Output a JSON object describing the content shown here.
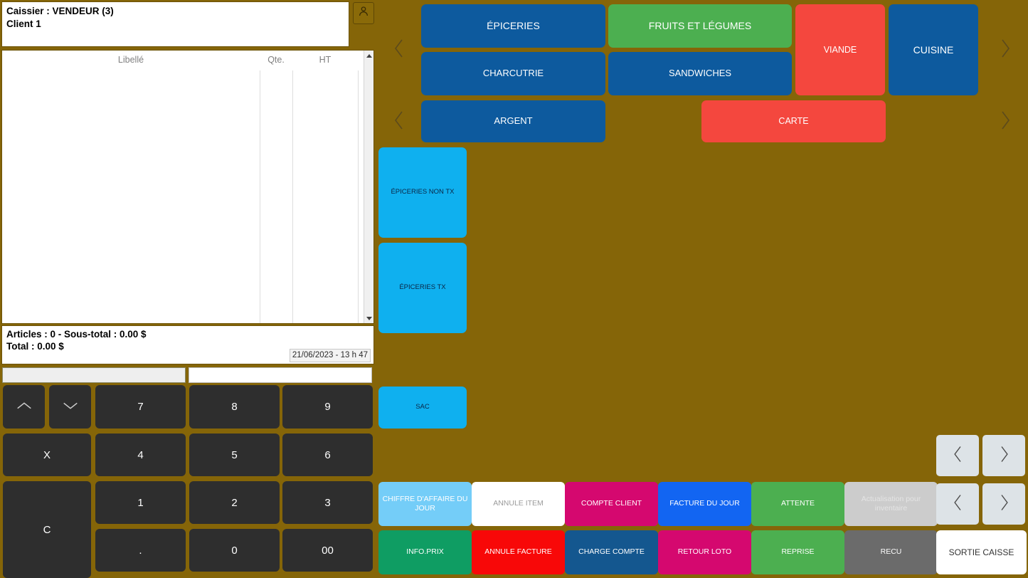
{
  "theme": {
    "background": "#856508",
    "blue": "#0d5a9e",
    "green": "#4caf50",
    "red": "#f4473e",
    "cyan": "#0fb0ef",
    "magenta": "#d5086f",
    "bright_blue": "#1265f2",
    "teal_green": "#0f9d63",
    "pure_red": "#f80808",
    "light_blue": "#74cdf8",
    "white": "#ffffff",
    "gray_disabled": "#cccccc",
    "gray": "#6b6b6b",
    "nav_gray": "#dde3e7",
    "key_dark": "#2e2e2e"
  },
  "header": {
    "cashier_line": "Caissier : VENDEUR (3)",
    "client_line": "Client 1",
    "user_icon": "person-icon"
  },
  "items_table": {
    "columns": [
      "Libellé",
      "Qte.",
      "HT"
    ],
    "rows": [],
    "scrollbar": {
      "up_icon": "triangle-up-icon",
      "down_icon": "triangle-down-icon"
    }
  },
  "totals": {
    "line1": "Articles : 0 - Sous-total : 0.00 $",
    "line2": "Total : 0.00 $",
    "datetime": "21/06/2023 - 13 h 47"
  },
  "fields": {
    "left_value": "",
    "right_value": ""
  },
  "keypad": {
    "up_icon": "chevron-up-icon",
    "down_icon": "chevron-down-icon",
    "multiply": "X",
    "clear": "C",
    "k7": "7",
    "k8": "8",
    "k9": "9",
    "k4": "4",
    "k5": "5",
    "k6": "6",
    "k1": "1",
    "k2": "2",
    "k3": "3",
    "dot": ".",
    "k0": "0",
    "k00": "00"
  },
  "categories": [
    {
      "label": "ÉPICERIES",
      "color": "#0d5a9e",
      "font": 14
    },
    {
      "label": "FRUITS ET LÉGUMES",
      "color": "#4caf50",
      "font": 14
    },
    {
      "label": "VIANDE",
      "color": "#f4473e",
      "font": 12.5
    },
    {
      "label": "CUISINE",
      "color": "#0d5a9e",
      "font": 14
    },
    {
      "label": "CHARCUTRIE",
      "color": "#0d5a9e",
      "font": 13
    },
    {
      "label": "SANDWICHES",
      "color": "#0d5a9e",
      "font": 13
    },
    {
      "label": "ARGENT",
      "color": "#0d5a9e",
      "font": 13
    },
    {
      "label": "CARTE",
      "color": "#f4473e",
      "font": 12.5
    }
  ],
  "side_categories": [
    {
      "label": "ÉPICERIES NON TX",
      "color": "#0fb0ef",
      "font": 9.5
    },
    {
      "label": "ÉPICERIES TX",
      "color": "#0fb0ef",
      "font": 9.5
    },
    {
      "label": "SAC",
      "color": "#0fb0ef",
      "font": 9.5
    }
  ],
  "nav": {
    "prev_icon": "chevron-left-icon",
    "next_icon": "chevron-right-icon"
  },
  "actions_row1": [
    {
      "label": "CHIFFRE D'AFFAIRE DU JOUR",
      "bg": "#74cdf8",
      "fg": "#ffffff"
    },
    {
      "label": "ANNULE ITEM",
      "bg": "#ffffff",
      "fg": "#9a9a9a"
    },
    {
      "label": "COMPTE CLIENT",
      "bg": "#d5086f",
      "fg": "#ffffff"
    },
    {
      "label": "FACTURE DU JOUR",
      "bg": "#1265f2",
      "fg": "#ffffff"
    },
    {
      "label": "ATTENTE",
      "bg": "#4caf50",
      "fg": "#ffffff"
    },
    {
      "label": "Actualisation pour inventaire",
      "bg": "#cccccc",
      "fg": "#e4e4e4"
    }
  ],
  "actions_row2": [
    {
      "label": "INFO.PRIX",
      "bg": "#0f9d63",
      "fg": "#ffffff"
    },
    {
      "label": "ANNULE FACTURE",
      "bg": "#f80808",
      "fg": "#ffffff"
    },
    {
      "label": "CHARGE COMPTE",
      "bg": "#14578f",
      "fg": "#ffffff"
    },
    {
      "label": "RETOUR LOTO",
      "bg": "#d5086f",
      "fg": "#ffffff"
    },
    {
      "label": "REPRISE",
      "bg": "#4caf50",
      "fg": "#ffffff"
    },
    {
      "label": "RECU",
      "bg": "#6b6b6b",
      "fg": "#ffffff"
    },
    {
      "label": "SORTIE CAISSE",
      "bg": "#ffffff",
      "fg": "#333333"
    }
  ]
}
